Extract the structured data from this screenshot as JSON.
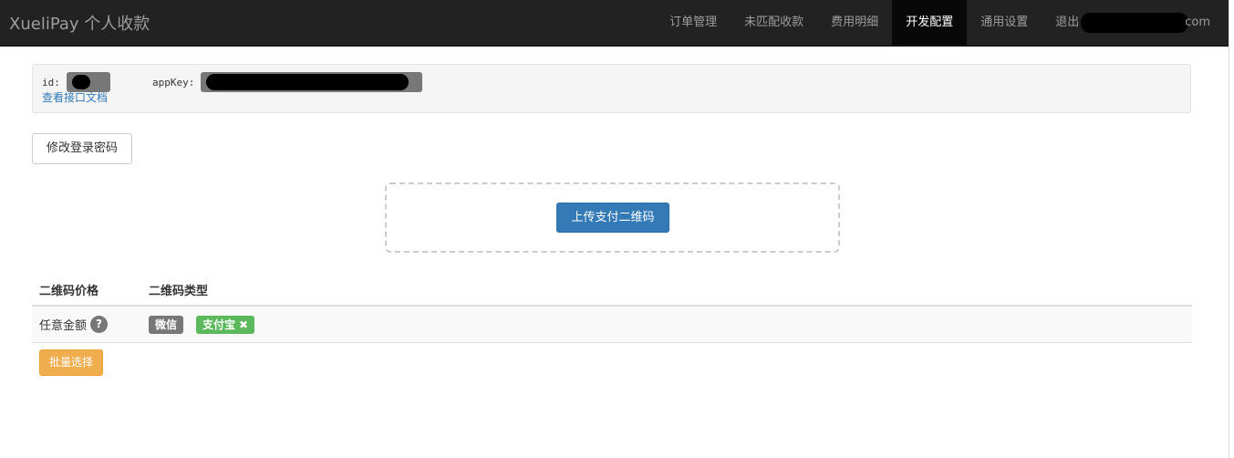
{
  "navbar": {
    "brand": "XueliPay 个人收款",
    "items": [
      {
        "label": "订单管理",
        "active": false
      },
      {
        "label": "未匹配收款",
        "active": false
      },
      {
        "label": "费用明细",
        "active": false
      },
      {
        "label": "开发配置",
        "active": true
      },
      {
        "label": "通用设置",
        "active": false
      }
    ],
    "logout_label": "退出",
    "account_suffix": "com"
  },
  "api_info": {
    "id_label": "id:",
    "appkey_label": "appKey:",
    "doc_link": "查看接口文档"
  },
  "buttons": {
    "change_password": "修改登录密码",
    "upload_qrcode": "上传支付二维码",
    "batch_select": "批量选择"
  },
  "qrcode_table": {
    "headers": [
      "二维码价格",
      "二维码类型"
    ],
    "rows": [
      {
        "price": "任意金额",
        "help_icon": "?",
        "types": [
          {
            "label": "微信",
            "color": "#777777",
            "removable": false
          },
          {
            "label": "支付宝",
            "color": "#5cb85c",
            "removable": true
          }
        ]
      }
    ]
  },
  "icons": {
    "help": "question-circle-icon",
    "remove": "times-icon"
  },
  "colors": {
    "navbar_bg": "#222222",
    "active_nav_bg": "#080808",
    "primary": "#337ab7",
    "warning": "#f0ad4e",
    "success": "#5cb85c",
    "label_default": "#777777",
    "link": "#337ab7"
  }
}
